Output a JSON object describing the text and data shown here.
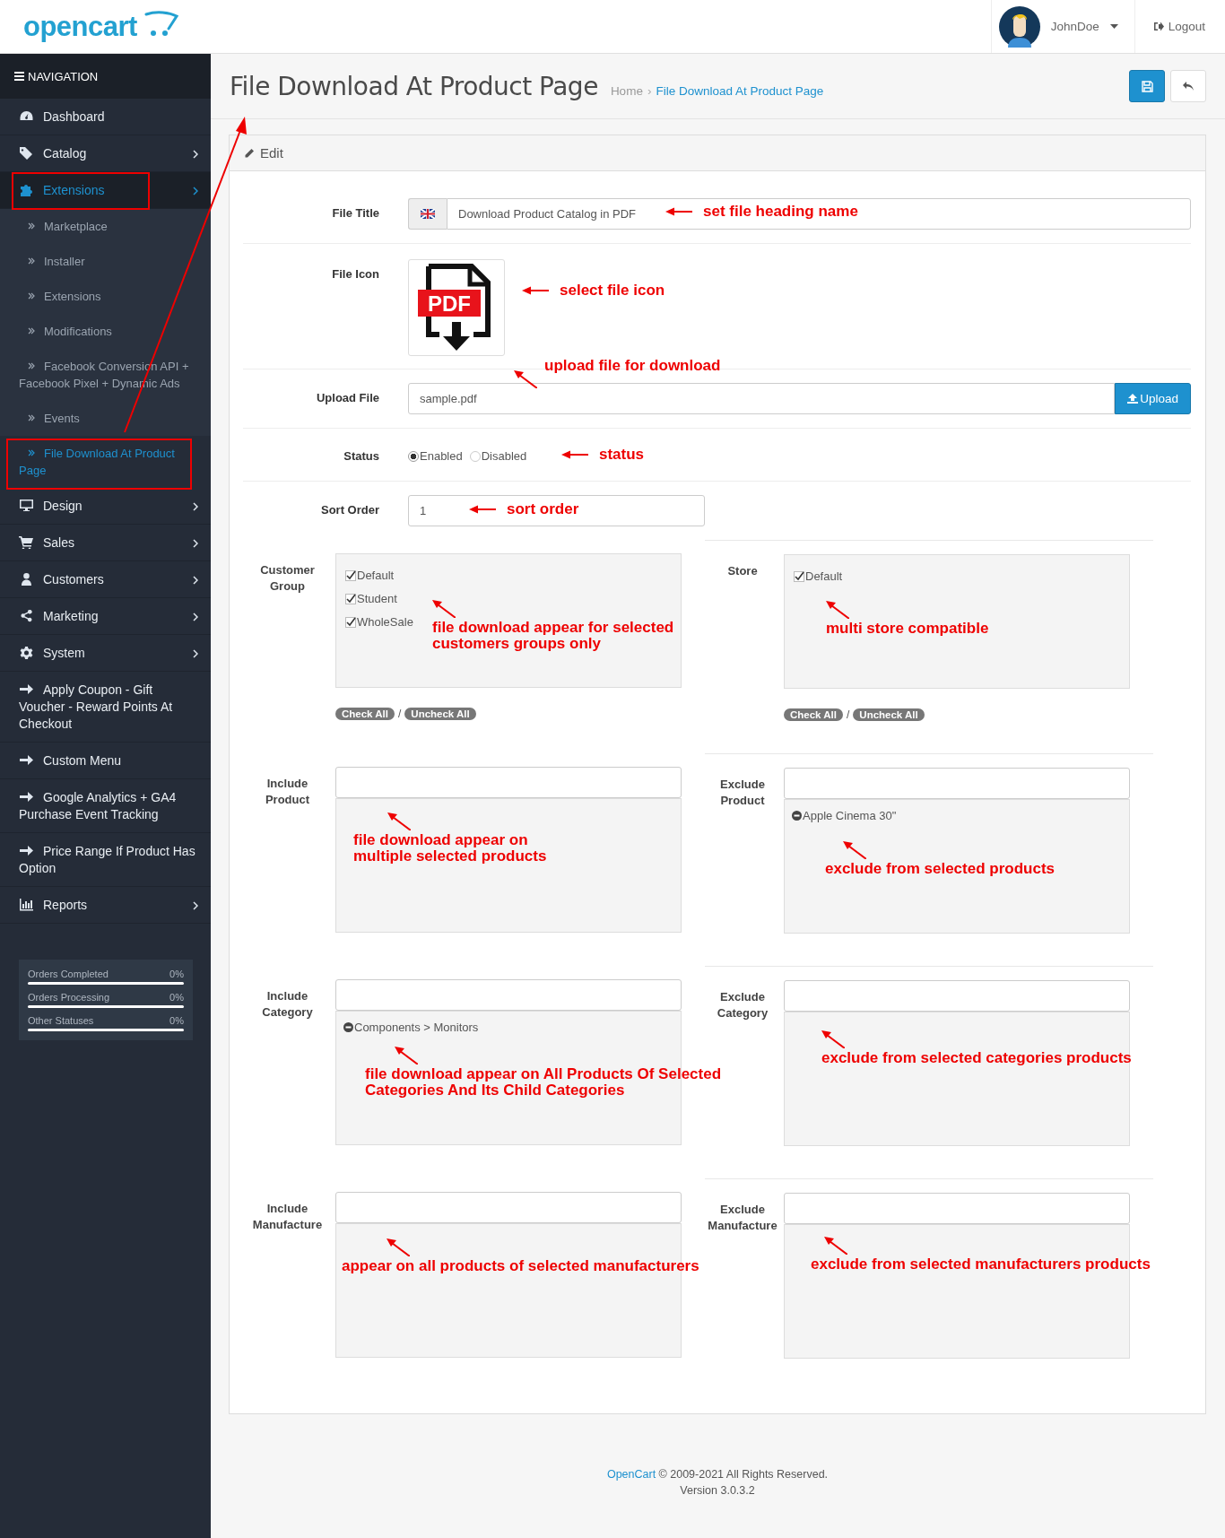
{
  "header": {
    "logo": "opencart",
    "user": "JohnDoe",
    "logout": "Logout"
  },
  "sidebar": {
    "title": "NAVIGATION",
    "items": [
      {
        "label": "Dashboard",
        "expandable": false,
        "selected": false,
        "highlighted": false
      },
      {
        "label": "Catalog",
        "expandable": true,
        "selected": false,
        "highlighted": false
      },
      {
        "label": "Extensions",
        "expandable": true,
        "selected": true,
        "highlighted": true,
        "children": [
          {
            "label": "Marketplace",
            "selected": false,
            "highlighted": false
          },
          {
            "label": "Installer",
            "selected": false,
            "highlighted": false
          },
          {
            "label": "Extensions",
            "selected": false,
            "highlighted": false
          },
          {
            "label": "Modifications",
            "selected": false,
            "highlighted": false
          },
          {
            "label": "Facebook Conversion API + Facebook Pixel + Dynamic Ads",
            "selected": false,
            "highlighted": false
          },
          {
            "label": "Events",
            "selected": false,
            "highlighted": false
          },
          {
            "label": "File Download At Product Page",
            "selected": true,
            "highlighted": true
          }
        ]
      },
      {
        "label": "Design",
        "expandable": true,
        "selected": false,
        "highlighted": false
      },
      {
        "label": "Sales",
        "expandable": true,
        "selected": false,
        "highlighted": false
      },
      {
        "label": "Customers",
        "expandable": true,
        "selected": false,
        "highlighted": false
      },
      {
        "label": "Marketing",
        "expandable": true,
        "selected": false,
        "highlighted": false
      },
      {
        "label": "System",
        "expandable": true,
        "selected": false,
        "highlighted": false
      },
      {
        "label": "Apply Coupon - Gift Voucher - Reward Points At Checkout",
        "expandable": false,
        "selected": false,
        "highlighted": false
      },
      {
        "label": "Custom Menu",
        "expandable": false,
        "selected": false,
        "highlighted": false
      },
      {
        "label": "Google Analytics + GA4 Purchase Event Tracking",
        "expandable": false,
        "selected": false,
        "highlighted": false
      },
      {
        "label": "Price Range If Product Has Option",
        "expandable": false,
        "selected": false,
        "highlighted": false
      },
      {
        "label": "Reports",
        "expandable": true,
        "selected": false,
        "highlighted": false
      }
    ],
    "stats": [
      {
        "label": "Orders Completed",
        "reading": "0%",
        "level": 0
      },
      {
        "label": "Orders Processing",
        "reading": "0%",
        "level": 0
      },
      {
        "label": "Other Statuses",
        "reading": "0%",
        "level": 0
      }
    ]
  },
  "page": {
    "title": "File Download At Product Page",
    "breadcrumb": [
      {
        "label": "Home",
        "selected": false
      },
      {
        "separator": "›",
        "label": "File Download At Product Page",
        "selected": true
      }
    ]
  },
  "panel": {
    "heading": "Edit",
    "fields": [
      {
        "kind": "lang-text",
        "label": "File Title",
        "value": "Download Product Catalog in PDF",
        "note": {
          "text": "set file heading name",
          "kind": "left"
        }
      },
      {
        "kind": "image",
        "label": "File Icon",
        "icon_text": "PDF",
        "note": {
          "text": "select file icon",
          "kind": "left"
        }
      },
      {
        "kind": "file",
        "label": "Upload File",
        "value": "sample.pdf",
        "button": "Upload",
        "note": {
          "text": "upload file for download",
          "kind": "up-left"
        }
      },
      {
        "kind": "radio",
        "label": "Status",
        "options": [
          {
            "label": "Enabled",
            "selected": true
          },
          {
            "label": "Disabled",
            "selected": false
          }
        ],
        "note": {
          "text": "status",
          "kind": "left"
        }
      },
      {
        "kind": "short-text",
        "label": "Sort Order",
        "value": "1",
        "note": {
          "text": "sort order",
          "kind": "left"
        }
      }
    ],
    "pairs": [
      [
        {
          "kind": "checklist",
          "label": "Customer Group",
          "items": [
            {
              "label": "Default",
              "checked": true
            },
            {
              "label": "Student",
              "checked": true
            },
            {
              "label": "WholeSale",
              "checked": true
            }
          ],
          "actions": {
            "check": "Check All",
            "separator": "/",
            "uncheck": "Uncheck All"
          },
          "note": {
            "text": "file download appear for selected customers groups only",
            "kind": "up-left"
          }
        },
        {
          "kind": "checklist",
          "label": "Store",
          "items": [
            {
              "label": "Default",
              "checked": true
            }
          ],
          "actions": {
            "check": "Check All",
            "separator": "/",
            "uncheck": "Uncheck All"
          },
          "note": {
            "text": "multi store compatible",
            "kind": "up-left"
          }
        }
      ],
      [
        {
          "kind": "autocomplete",
          "label": "Include Product",
          "note": {
            "text": "file download appear on multiple selected products",
            "kind": "up-left"
          }
        },
        {
          "kind": "autocomplete",
          "label": "Exclude Product",
          "items": [
            "Apple Cinema 30\""
          ],
          "note": {
            "text": "exclude from selected products",
            "kind": "up-left"
          }
        }
      ],
      [
        {
          "kind": "autocomplete",
          "label": "Include Category",
          "items": [
            "Components > Monitors"
          ],
          "note": {
            "text": "file download appear on All Products Of Selected Categories And Its Child Categories",
            "kind": "up-left"
          }
        },
        {
          "kind": "autocomplete",
          "label": "Exclude Category",
          "note": {
            "text": "exclude from selected categories products",
            "kind": "up-left"
          }
        }
      ],
      [
        {
          "kind": "autocomplete",
          "label": "Include Manufacture",
          "note": {
            "text": "appear on all products of selected manufacturers",
            "kind": "up-left"
          }
        },
        {
          "kind": "autocomplete",
          "label": "Exclude Manufacture",
          "note": {
            "text": "exclude from selected manufacturers products",
            "kind": "up-left"
          }
        }
      ]
    ]
  },
  "footer": {
    "link": "OpenCart",
    "text": "© 2009-2021 All Rights Reserved.",
    "version": "Version 3.0.3.2"
  }
}
